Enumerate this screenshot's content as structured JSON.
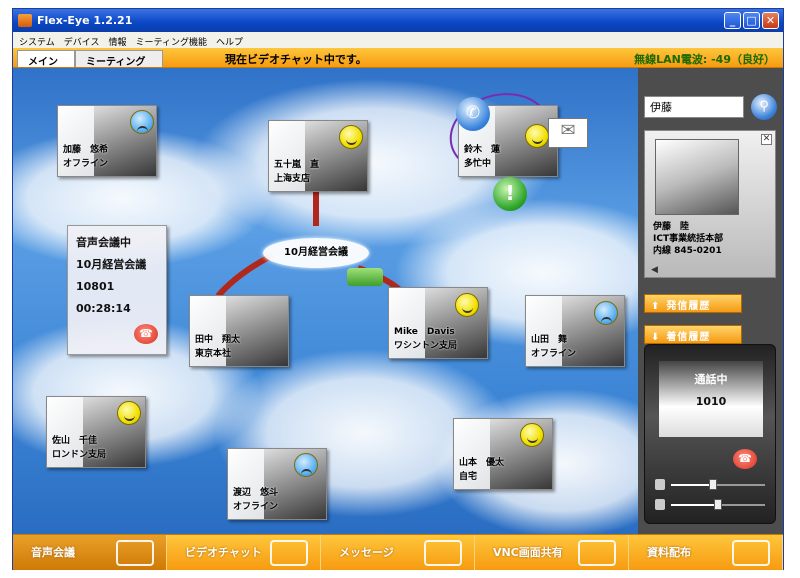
{
  "window": {
    "title": "Flex-Eye 1.2.21",
    "buttons": {
      "minimize": "_",
      "maximize": "□",
      "close": "✕"
    }
  },
  "menu": [
    "システム",
    "デバイス",
    "情報",
    "ミーティング機能",
    "ヘルプ"
  ],
  "tabs": [
    {
      "label": "メイン"
    },
    {
      "label": "ミーティング"
    }
  ],
  "status_text": "現在ビデオチャット中です。",
  "wlan_text": "無線LAN電波: -49（良好）",
  "conference": {
    "state": "音声会議中",
    "name": "10月経営会議",
    "number": "10801",
    "duration": "00:28:14"
  },
  "meeting_label": "10月経営会議",
  "contacts": [
    {
      "name": "加藤　悠希",
      "status": "オフライン",
      "mood": "sad"
    },
    {
      "name": "五十嵐　直",
      "status": "上海支店",
      "mood": "happy"
    },
    {
      "name": "鈴木　蓮",
      "status": "多忙中",
      "mood": "happy"
    },
    {
      "name": "田中　翔太",
      "status": "東京本社",
      "mood": "none"
    },
    {
      "name": "Mike　Davis",
      "status": "ワシントン支局",
      "mood": "happy"
    },
    {
      "name": "山田　舞",
      "status": "オフライン",
      "mood": "sad"
    },
    {
      "name": "佐山　千佳",
      "status": "ロンドン支局",
      "mood": "happy"
    },
    {
      "name": "山本　優太",
      "status": "自宅",
      "mood": "happy"
    },
    {
      "name": "渡辺　悠斗",
      "status": "オフライン",
      "mood": "sad"
    }
  ],
  "search": {
    "value": "伊藤"
  },
  "profile": {
    "name": "伊藤　陸",
    "department": "ICT事業統括本部",
    "extension": "内線 845-0201"
  },
  "history": {
    "outgoing": "発信履歴",
    "incoming": "着信履歴"
  },
  "call": {
    "state": "通話中",
    "number": "1010",
    "levels": [
      0.45,
      0.5
    ]
  },
  "bottom_buttons": [
    {
      "label": "音声会議"
    },
    {
      "label": "ビデオチャット"
    },
    {
      "label": "メッセージ"
    },
    {
      "label": "VNC画面共有"
    },
    {
      "label": "資料配布"
    }
  ],
  "colors": {
    "accent": "#f79b10",
    "sky": "#3d86d6",
    "panel": "#4d4d4d"
  }
}
